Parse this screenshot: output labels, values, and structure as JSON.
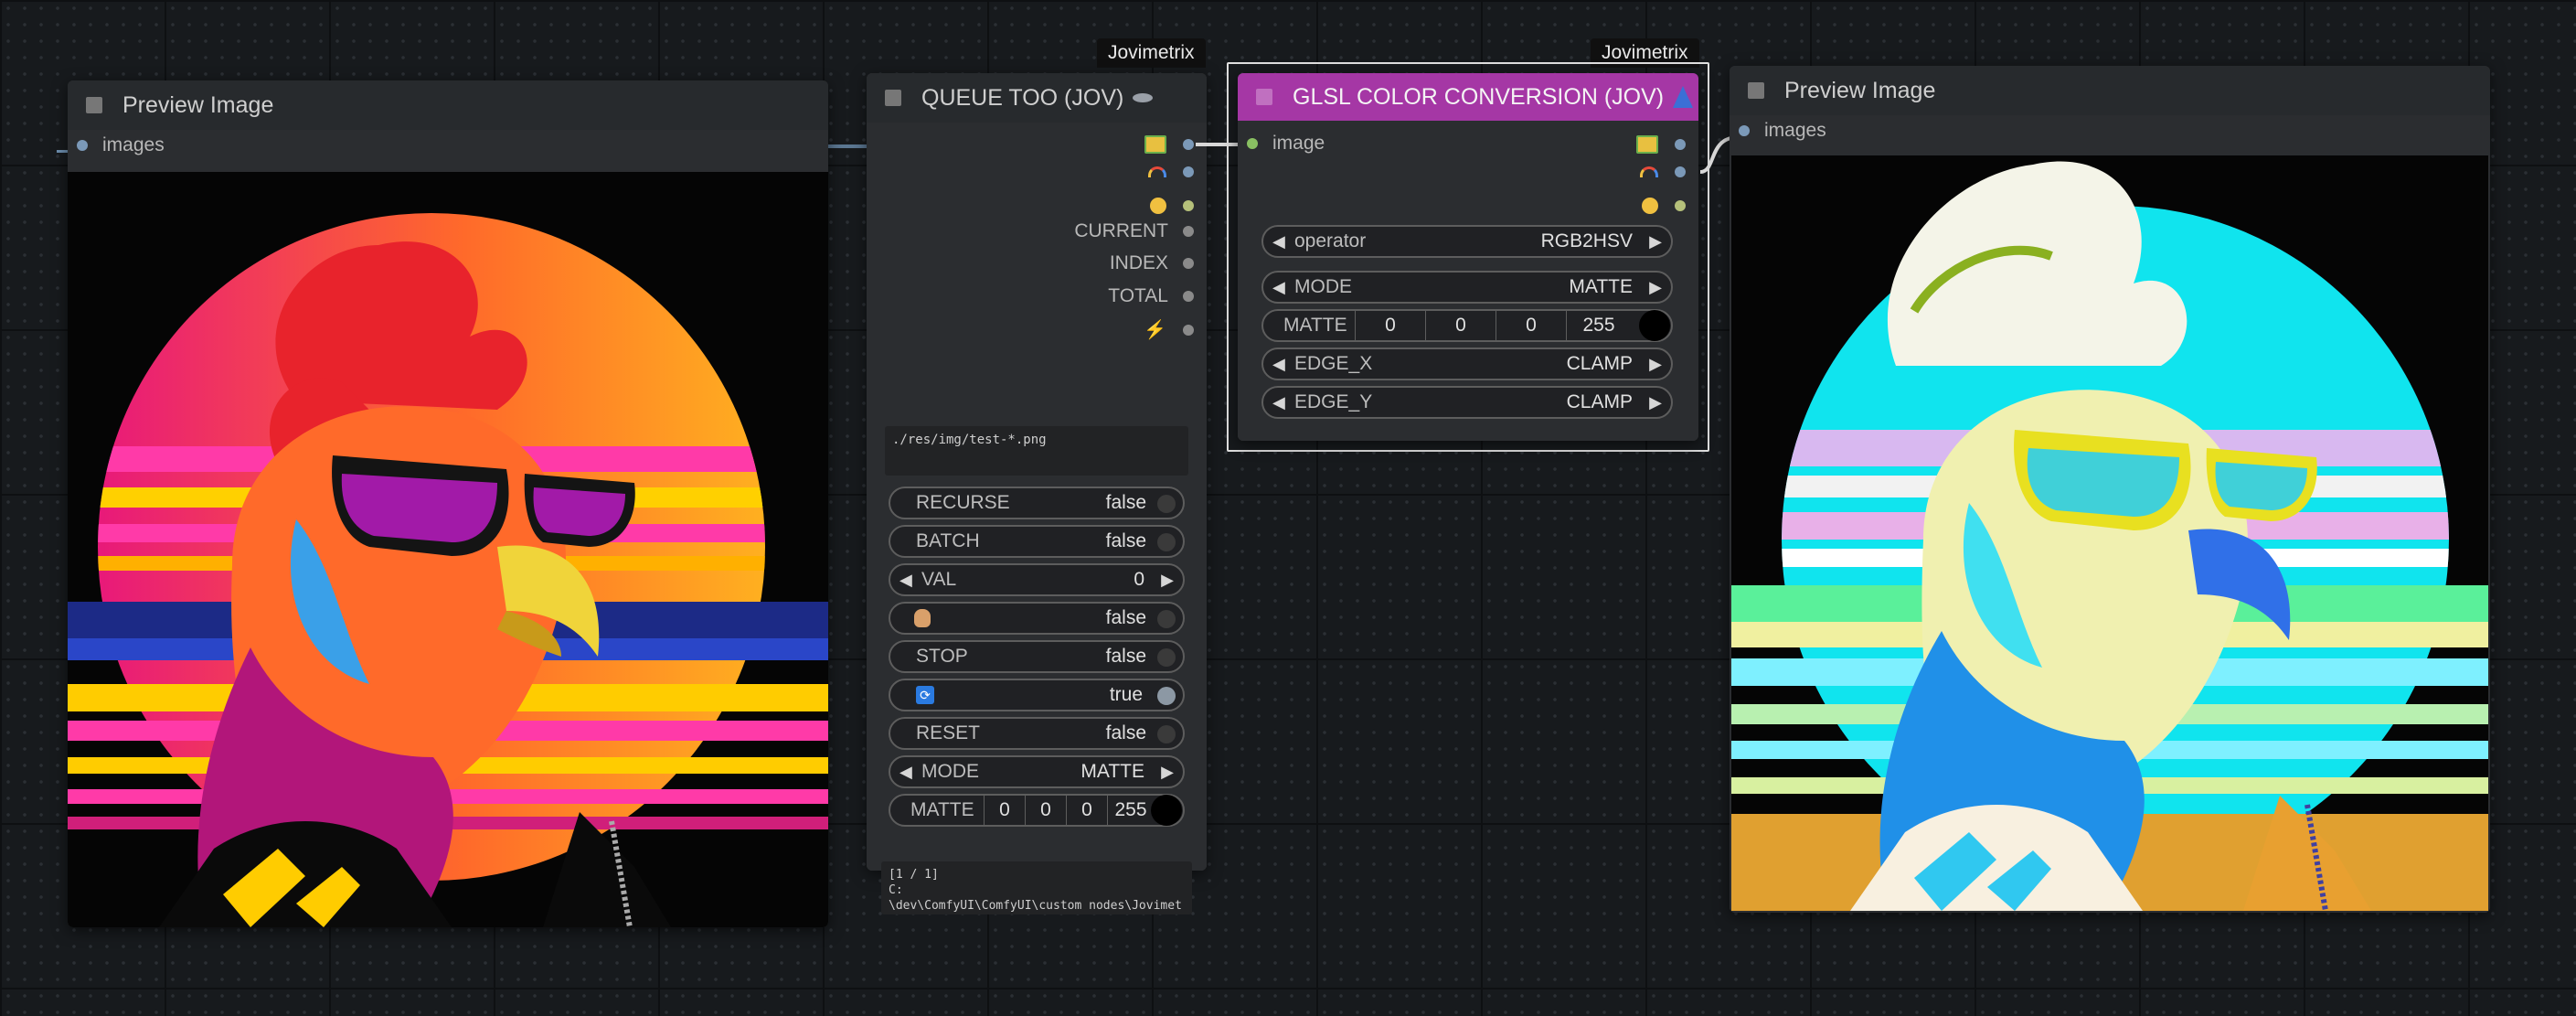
{
  "nodes": {
    "preview_left": {
      "title": "Preview Image",
      "input_label": "images"
    },
    "queue": {
      "title": "QUEUE TOO (JOV)",
      "title_icon": "ufo-emoji",
      "source": "Jovimetrix",
      "outputs": [
        "CURRENT",
        "INDEX",
        "TOTAL"
      ],
      "path_value": "./res/img/test-*.png",
      "widgets": {
        "recurse": {
          "label": "RECURSE",
          "value": "false"
        },
        "batch": {
          "label": "BATCH",
          "value": "false"
        },
        "val": {
          "label": "VAL",
          "value": "0"
        },
        "hold": {
          "icon": "hand-emoji",
          "value": "false"
        },
        "stop": {
          "label": "STOP",
          "value": "false"
        },
        "loop": {
          "icon": "loop-emoji",
          "value": "true"
        },
        "reset": {
          "label": "RESET",
          "value": "false"
        },
        "mode": {
          "label": "MODE",
          "value": "MATTE"
        },
        "matte": {
          "label": "MATTE",
          "r": "0",
          "g": "0",
          "b": "0",
          "a": "255"
        }
      },
      "status_text": "[1 / 1]\nC:\n\\dev\\ComfyUI\\ComfyUI\\custom nodes\\Jovimet"
    },
    "glsl": {
      "title": "GLSL COLOR CONVERSION (JOV)",
      "title_icon": "wizard-emoji",
      "source": "Jovimetrix",
      "title_color": "#a537a5",
      "input_label": "image",
      "widgets": {
        "operator": {
          "label": "operator",
          "value": "RGB2HSV"
        },
        "mode": {
          "label": "MODE",
          "value": "MATTE"
        },
        "matte": {
          "label": "MATTE",
          "r": "0",
          "g": "0",
          "b": "0",
          "a": "255"
        },
        "edge_x": {
          "label": "EDGE_X",
          "value": "CLAMP"
        },
        "edge_y": {
          "label": "EDGE_Y",
          "value": "CLAMP"
        }
      }
    },
    "preview_right": {
      "title": "Preview Image",
      "input_label": "images"
    }
  }
}
